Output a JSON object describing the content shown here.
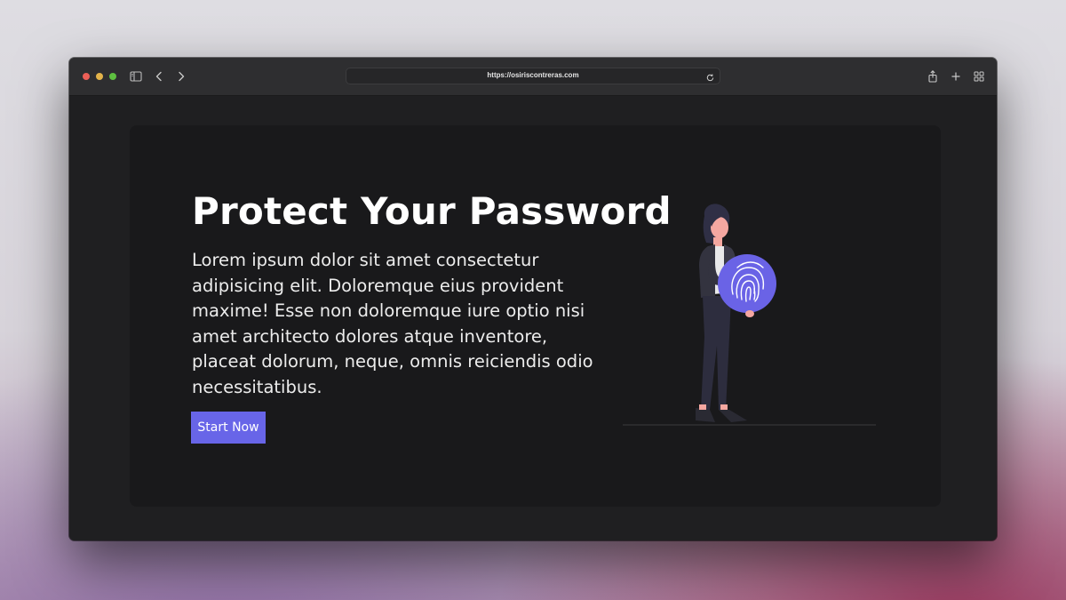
{
  "browser": {
    "url": "https://osiriscontreras.com",
    "icons": [
      "sidebar-icon",
      "back-icon",
      "forward-icon",
      "reload-icon",
      "share-icon",
      "new-tab-icon",
      "tab-overview-icon"
    ]
  },
  "hero": {
    "title": "Protect Your Password",
    "description": "Lorem ipsum dolor sit amet consectetur adipisicing elit. Doloremque eius provident maxime! Esse non doloremque iure optio nisi amet architecto dolores atque inventore, placeat dolorum, neque, omnis reiciendis odio necessitatibus.",
    "cta_label": "Start Now",
    "accent_color": "#6865e8"
  },
  "illustration": {
    "subject": "person-holding-fingerprint",
    "icon": "fingerprint-icon"
  }
}
